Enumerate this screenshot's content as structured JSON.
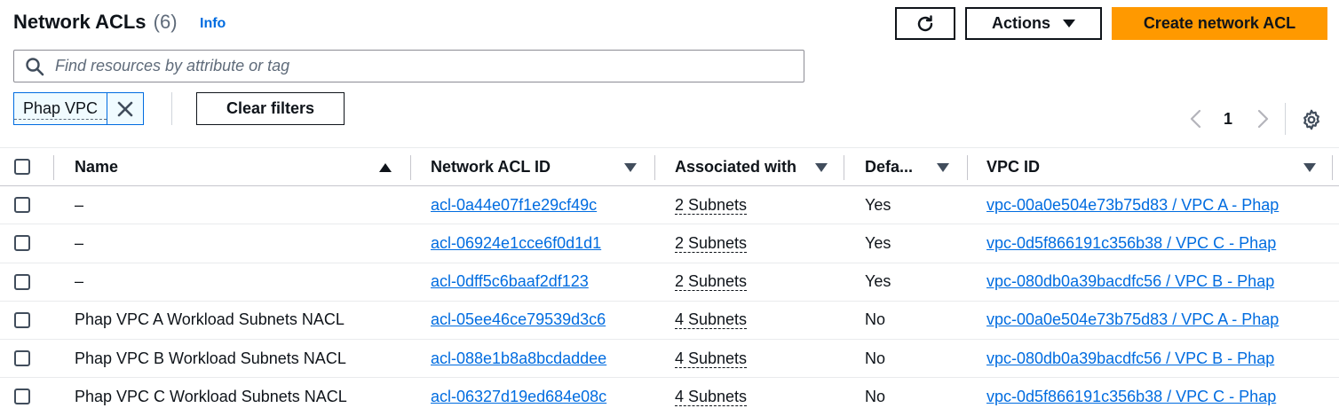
{
  "header": {
    "title": "Network ACLs",
    "count": "(6)",
    "info_label": "Info"
  },
  "toolbar": {
    "actions_label": "Actions",
    "create_label": "Create network ACL"
  },
  "search": {
    "placeholder": "Find resources by attribute or tag"
  },
  "filters": {
    "tokens": [
      {
        "label": "Phap VPC"
      }
    ],
    "clear_label": "Clear filters"
  },
  "pagination": {
    "current_page": "1"
  },
  "table": {
    "columns": [
      {
        "label": "Name",
        "sort": "ascending"
      },
      {
        "label": "Network ACL ID",
        "sort": "none"
      },
      {
        "label": "Associated with",
        "sort": "none"
      },
      {
        "label": "Defa...",
        "sort": "none"
      },
      {
        "label": "VPC ID",
        "sort": "none"
      }
    ],
    "rows": [
      {
        "name": "–",
        "acl_id": "acl-0a44e07f1e29cf49c",
        "associated": "2 Subnets",
        "default": "Yes",
        "vpc": "vpc-00a0e504e73b75d83 / VPC A - Phap"
      },
      {
        "name": "–",
        "acl_id": "acl-06924e1cce6f0d1d1",
        "associated": "2 Subnets",
        "default": "Yes",
        "vpc": "vpc-0d5f866191c356b38 / VPC C - Phap"
      },
      {
        "name": "–",
        "acl_id": "acl-0dff5c6baaf2df123",
        "associated": "2 Subnets",
        "default": "Yes",
        "vpc": "vpc-080db0a39bacdfc56 / VPC B - Phap"
      },
      {
        "name": "Phap VPC A Workload Subnets NACL",
        "acl_id": "acl-05ee46ce79539d3c6",
        "associated": "4 Subnets",
        "default": "No",
        "vpc": "vpc-00a0e504e73b75d83 / VPC A - Phap"
      },
      {
        "name": "Phap VPC B Workload Subnets NACL",
        "acl_id": "acl-088e1b8a8bcdaddee",
        "associated": "4 Subnets",
        "default": "No",
        "vpc": "vpc-080db0a39bacdfc56 / VPC B - Phap"
      },
      {
        "name": "Phap VPC C Workload Subnets NACL",
        "acl_id": "acl-06327d19ed684e08c",
        "associated": "4 Subnets",
        "default": "No",
        "vpc": "vpc-0d5f866191c356b38 / VPC C - Phap"
      }
    ]
  },
  "colors": {
    "primary_button": "#ff9900",
    "link": "#006ce0",
    "text": "#0f141a",
    "token_border": "#006ce0"
  },
  "icons": [
    "refresh-icon",
    "caret-down-icon",
    "search-icon",
    "close-icon",
    "chevron-left-icon",
    "chevron-right-icon",
    "gear-icon",
    "sort-ascending-icon",
    "sort-descending-icon"
  ]
}
